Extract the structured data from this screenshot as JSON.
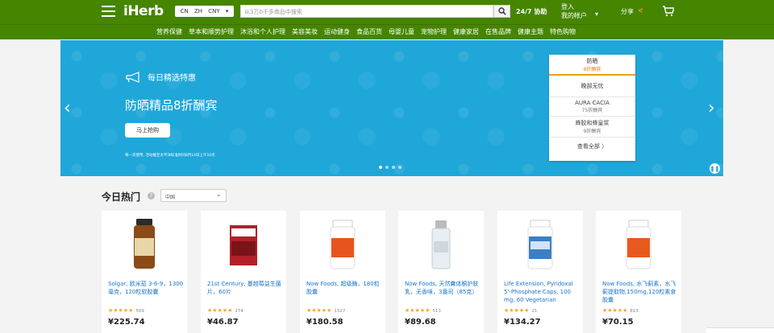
{
  "header": {
    "logo": "iHerb",
    "lang": {
      "cn": "CN",
      "zh": "ZH",
      "cny": "CNY"
    },
    "search_placeholder": "从3万0千多商品中搜索",
    "support": "24/7 协助",
    "account_line1": "登入",
    "account_line2": "我的帐户",
    "share": "分享"
  },
  "nav": {
    "items": [
      "营养保健",
      "草本和顺势护理",
      "沐浴和个人护理",
      "美容美妆",
      "运动健身",
      "食品百货",
      "母婴儿童",
      "宠物护理",
      "健康家居",
      "在售品牌",
      "健康主题",
      "特色购物"
    ]
  },
  "hero": {
    "subtitle": "每日精选特惠",
    "title": "防晒精品8折酬宾",
    "button": "马上抢购",
    "note": "每一次使用, 活动截至太平洋标准时间8月14日上午10点"
  },
  "panel": {
    "head1": "防晒",
    "head2": "8折酬宾",
    "rows": [
      {
        "l1": "晚部无忧",
        "l2": ""
      },
      {
        "l1": "AURA CACIA",
        "l2": "75折酬宾"
      },
      {
        "l1": "蜂胶和蜂皇浆",
        "l2": "9折酬宾"
      },
      {
        "l1": "查看全部 〉",
        "l2": ""
      }
    ]
  },
  "trending": {
    "title": "今日热门",
    "region": "中国"
  },
  "products": [
    {
      "name": "Solgar, 欧米茄 3-6-9，1300毫克，120粒软胶囊",
      "rating": "★★★★★",
      "count": "569",
      "price": "¥225.74",
      "color": "#8a4b16"
    },
    {
      "name": "21st Century, 蔓越莓益生菌片，60片",
      "rating": "★★★★★",
      "count": "274",
      "price": "¥46.87",
      "color": "#b3202a"
    },
    {
      "name": "Now Foods, 超级酶，180粒胶囊",
      "rating": "★★★★★",
      "count": "1327",
      "price": "¥180.58",
      "color": "#e8541e"
    },
    {
      "name": "Now Foods, 天然糞体酮护肤乳，无香味，3盎司（85克）",
      "rating": "★★★★★",
      "count": "513",
      "price": "¥89.68",
      "color": "#cfd8dc"
    },
    {
      "name": "Life Extension, Pyridoxal 5'-Phosphate Caps, 100 mg, 60 Vegetarian",
      "rating": "★★★★★",
      "count": "21",
      "price": "¥134.27",
      "color": "#3b7fc4"
    },
    {
      "name": "Now Foods, 水飞蓟素，水飞蓟提取物,150mg,120粒素食胶囊",
      "rating": "★★★★★",
      "count": "813",
      "price": "¥70.15",
      "color": "#e85a1e"
    }
  ]
}
